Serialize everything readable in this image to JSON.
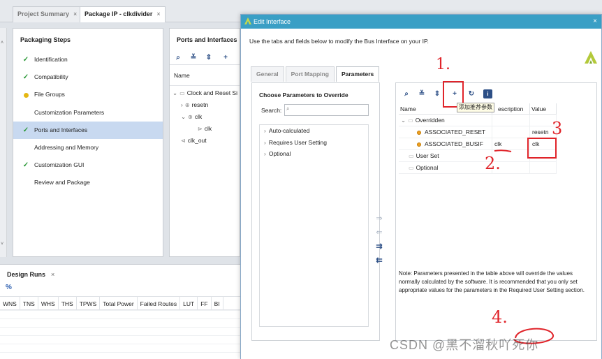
{
  "tabs": [
    {
      "label": "Project Summary",
      "close": "×"
    },
    {
      "label": "Package IP - clkdivider",
      "close": "×"
    }
  ],
  "packaging_steps": {
    "title": "Packaging Steps",
    "items": [
      {
        "label": "Identification",
        "status": "done"
      },
      {
        "label": "Compatibility",
        "status": "done"
      },
      {
        "label": "File Groups",
        "status": "warning"
      },
      {
        "label": "Customization Parameters",
        "status": "none"
      },
      {
        "label": "Ports and Interfaces",
        "status": "done"
      },
      {
        "label": "Addressing and Memory",
        "status": "none"
      },
      {
        "label": "Customization GUI",
        "status": "done"
      },
      {
        "label": "Review and Package",
        "status": "none"
      }
    ]
  },
  "ports": {
    "title": "Ports and Interfaces",
    "column": "Name",
    "rows": [
      "Clock and Reset Si",
      "resetn",
      "clk",
      "clk",
      "clk_out"
    ]
  },
  "design_runs": {
    "tab": "Design Runs",
    "close": "×",
    "pct": "%",
    "columns": [
      "WNS",
      "TNS",
      "WHS",
      "THS",
      "TPWS",
      "Total Power",
      "Failed Routes",
      "LUT",
      "FF",
      "BI"
    ]
  },
  "dialog": {
    "title": "Edit Interface",
    "close": "×",
    "description": "Use the tabs and fields below to modify the Bus Interface on your IP.",
    "tabs": [
      "General",
      "Port Mapping",
      "Parameters"
    ],
    "choose_title": "Choose Parameters to Override",
    "search_label": "Search:",
    "search_value": "",
    "categories": [
      "Auto-calculated",
      "Requires User Setting",
      "Optional"
    ],
    "tooltip": "添加推荐参数",
    "table": {
      "headers": [
        "Name",
        "escription",
        "Value"
      ],
      "rows": [
        {
          "name": "Overridden",
          "desc": "",
          "value": "",
          "kind": "folder"
        },
        {
          "name": "ASSOCIATED_RESET",
          "desc": "",
          "value": "resetn",
          "kind": "param"
        },
        {
          "name": "ASSOCIATED_BUSIF",
          "desc": "clk",
          "value": "clk",
          "kind": "param"
        },
        {
          "name": "User Set",
          "desc": "",
          "value": "",
          "kind": "folder"
        },
        {
          "name": "Optional",
          "desc": "",
          "value": "",
          "kind": "folder"
        }
      ]
    },
    "note": "Note: Parameters presented in the table above will override the values normally calculated by the software. It is recommended that you only set appropriate values for the parameters in the Required User Setting section."
  },
  "annotations": [
    "1.",
    "2.",
    "3",
    "4."
  ],
  "watermark": "CSDN @黑不溜秋吖死你",
  "colors": {
    "accent": "#3a9fc5",
    "annotation": "#e0242a",
    "check": "#2e9a3a",
    "selected": "#c8d9f0"
  }
}
